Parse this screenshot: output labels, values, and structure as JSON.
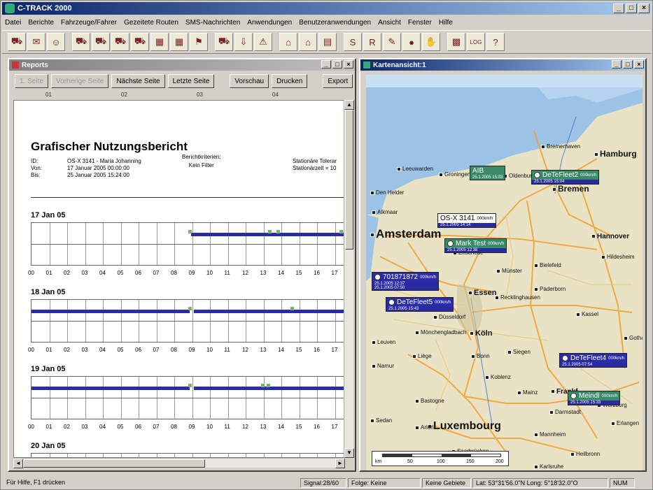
{
  "app": {
    "title": "C-TRACK 2000",
    "min": "_",
    "max": "□",
    "close": "×"
  },
  "menu": [
    "Datei",
    "Berichte",
    "Fahrzeuge/Fahrer",
    "Gezeitete Routen",
    "SMS-Nachrichten",
    "Anwendungen",
    "Benutzeranwendungen",
    "Ansicht",
    "Fenster",
    "Hilfe"
  ],
  "toolbar": {
    "icons": [
      "vehicle-report-icon",
      "message-icon",
      "driver-icon",
      "truck-icon",
      "truck-route-icon",
      "truck-multi-icon",
      "trip-icon",
      "report-grid-icon",
      "report-grid2-icon",
      "alert-icon",
      "fleet-icon",
      "download-icon",
      "warning-icon",
      "building-icon",
      "home-icon",
      "document-icon",
      "sms-icon",
      "r-icon",
      "edit-icon",
      "globe-icon",
      "hand-icon",
      "map-icon",
      "log-icon",
      "help-icon"
    ],
    "glyphs": [
      "⛟",
      "✉",
      "☺",
      "⛟",
      "⛟",
      "⛟",
      "⛟",
      "▦",
      "▦",
      "⚑",
      "⛟",
      "⇩",
      "⚠",
      "⌂",
      "⌂",
      "▤",
      "S",
      "R",
      "✎",
      "●",
      "✋",
      "▩",
      "LOG",
      "?"
    ]
  },
  "reports": {
    "title": "Reports",
    "buttons": {
      "first": "1. Seite",
      "prev": "Vorherige Seite",
      "next": "Nächste Seite",
      "last": "Letzte Seite",
      "preview": "Vorschau",
      "print": "Drucken",
      "export": "Export"
    },
    "ruler": [
      "01",
      "02",
      "03",
      "04"
    ],
    "heading": "Grafischer Nutzungsbericht",
    "meta": {
      "id_label": "ID:",
      "id_value": "OS-X 3141 - Maria Johanning",
      "from_label": "Von:",
      "from_value": "17 Januar 2005 00:00:00",
      "to_label": "Bis:",
      "to_value": "25 Januar 2005 15:24:00",
      "criteria_label": "Berichtkriterien:",
      "criteria_value": "Kein Filter",
      "tolerance": "Stationäre Tolerar",
      "stationary": "Stationärzeit = 10"
    },
    "days": [
      "17 Jan 05",
      "18 Jan 05",
      "19 Jan 05",
      "20 Jan 05"
    ],
    "hours": [
      "00",
      "01",
      "02",
      "03",
      "04",
      "05",
      "06",
      "07",
      "08",
      "09",
      "10",
      "11",
      "12",
      "13",
      "14",
      "15",
      "16",
      "17"
    ]
  },
  "map": {
    "title": "Kartenansicht:1",
    "cities": {
      "hamburg": "Hamburg",
      "bremerhaven": "Bremerhaven",
      "bremen": "Bremen",
      "amsterdam": "Amsterdam",
      "hannover": "Hannover",
      "essen": "Essen",
      "koln": "Köln",
      "luxembourg": "Luxembourg",
      "frankfurt": "Frankf",
      "groningen": "Groningen",
      "leeuwarden": "Leeuwarden",
      "denhelder": "Den Helder",
      "alkmaar": "Alkmaar",
      "enschede": "Enschede",
      "munster": "Münster",
      "bielefeld": "Bielefeld",
      "dusseldorf": "Düsseldorf",
      "kassel": "Kassel",
      "paderborn": "Paderborn",
      "hildesheim": "Hildesheim",
      "siegen": "Siegen",
      "koblenz": "Koblenz",
      "mainz": "Mainz",
      "darmstadt": "Darmstadt",
      "wurzburg": "Würzburg",
      "mannheim": "Mannheim",
      "saarbrucken": "Saarbrücken",
      "heilbronn": "Heilbronn",
      "karlsruhe": "Karlsruhe",
      "namur": "Namur",
      "liege": "Liège",
      "leuven": "Leuven",
      "bastogne": "Bastogne",
      "sedan": "Sedan",
      "arlon": "Arlon",
      "gotha": "Gotha",
      "erlangen": "Erlangen",
      "recklinghausen": "Recklinghausen",
      "monchengladbach": "Mönchengladbach",
      "bonn": "Bonn",
      "oldenburg": "Oldenburg"
    },
    "vehicles": [
      {
        "name": "AIB",
        "speed": "",
        "time": "25.1.2005 15:03",
        "style": "green"
      },
      {
        "name": "DeTeFleet2",
        "speed": "000km/h",
        "time": "25.1.2005 15:04",
        "style": "green"
      },
      {
        "name": "OS-X 3141",
        "speed": "000km/h",
        "time": "25.1.2005 14:14",
        "style": "white"
      },
      {
        "name": "Mark Test",
        "speed": "000km/h",
        "time": "25.1.2005 12:38",
        "style": "green"
      },
      {
        "name": "701871872",
        "speed": "000km/h",
        "time": "25.1.2005 12:37",
        "time2": "25.1.2005 07:50",
        "style": "blue"
      },
      {
        "name": "DeTeFleet5",
        "speed": "000km/h",
        "time": "25.1.2005 15:43",
        "style": "blue"
      },
      {
        "name": "DeTeFleet4",
        "speed": "000km/h",
        "time": "25.1.2005 07:54",
        "style": "blue"
      },
      {
        "name": "Meindl",
        "speed": "000km/h",
        "time": "25.1.2005 15:33",
        "style": "green"
      }
    ],
    "scale": {
      "unit": "km",
      "ticks": [
        "50",
        "100",
        "150",
        "200"
      ]
    }
  },
  "status": {
    "help": "Für Hilfe, F1 drücken",
    "signal": "Signal:28/60",
    "follow": "Folge: Keine",
    "zones": "Keine Gebiete",
    "coords": "Lat: 53°31'56.0\"N Long:  5°18'32.0\"O",
    "num": "NUM"
  }
}
